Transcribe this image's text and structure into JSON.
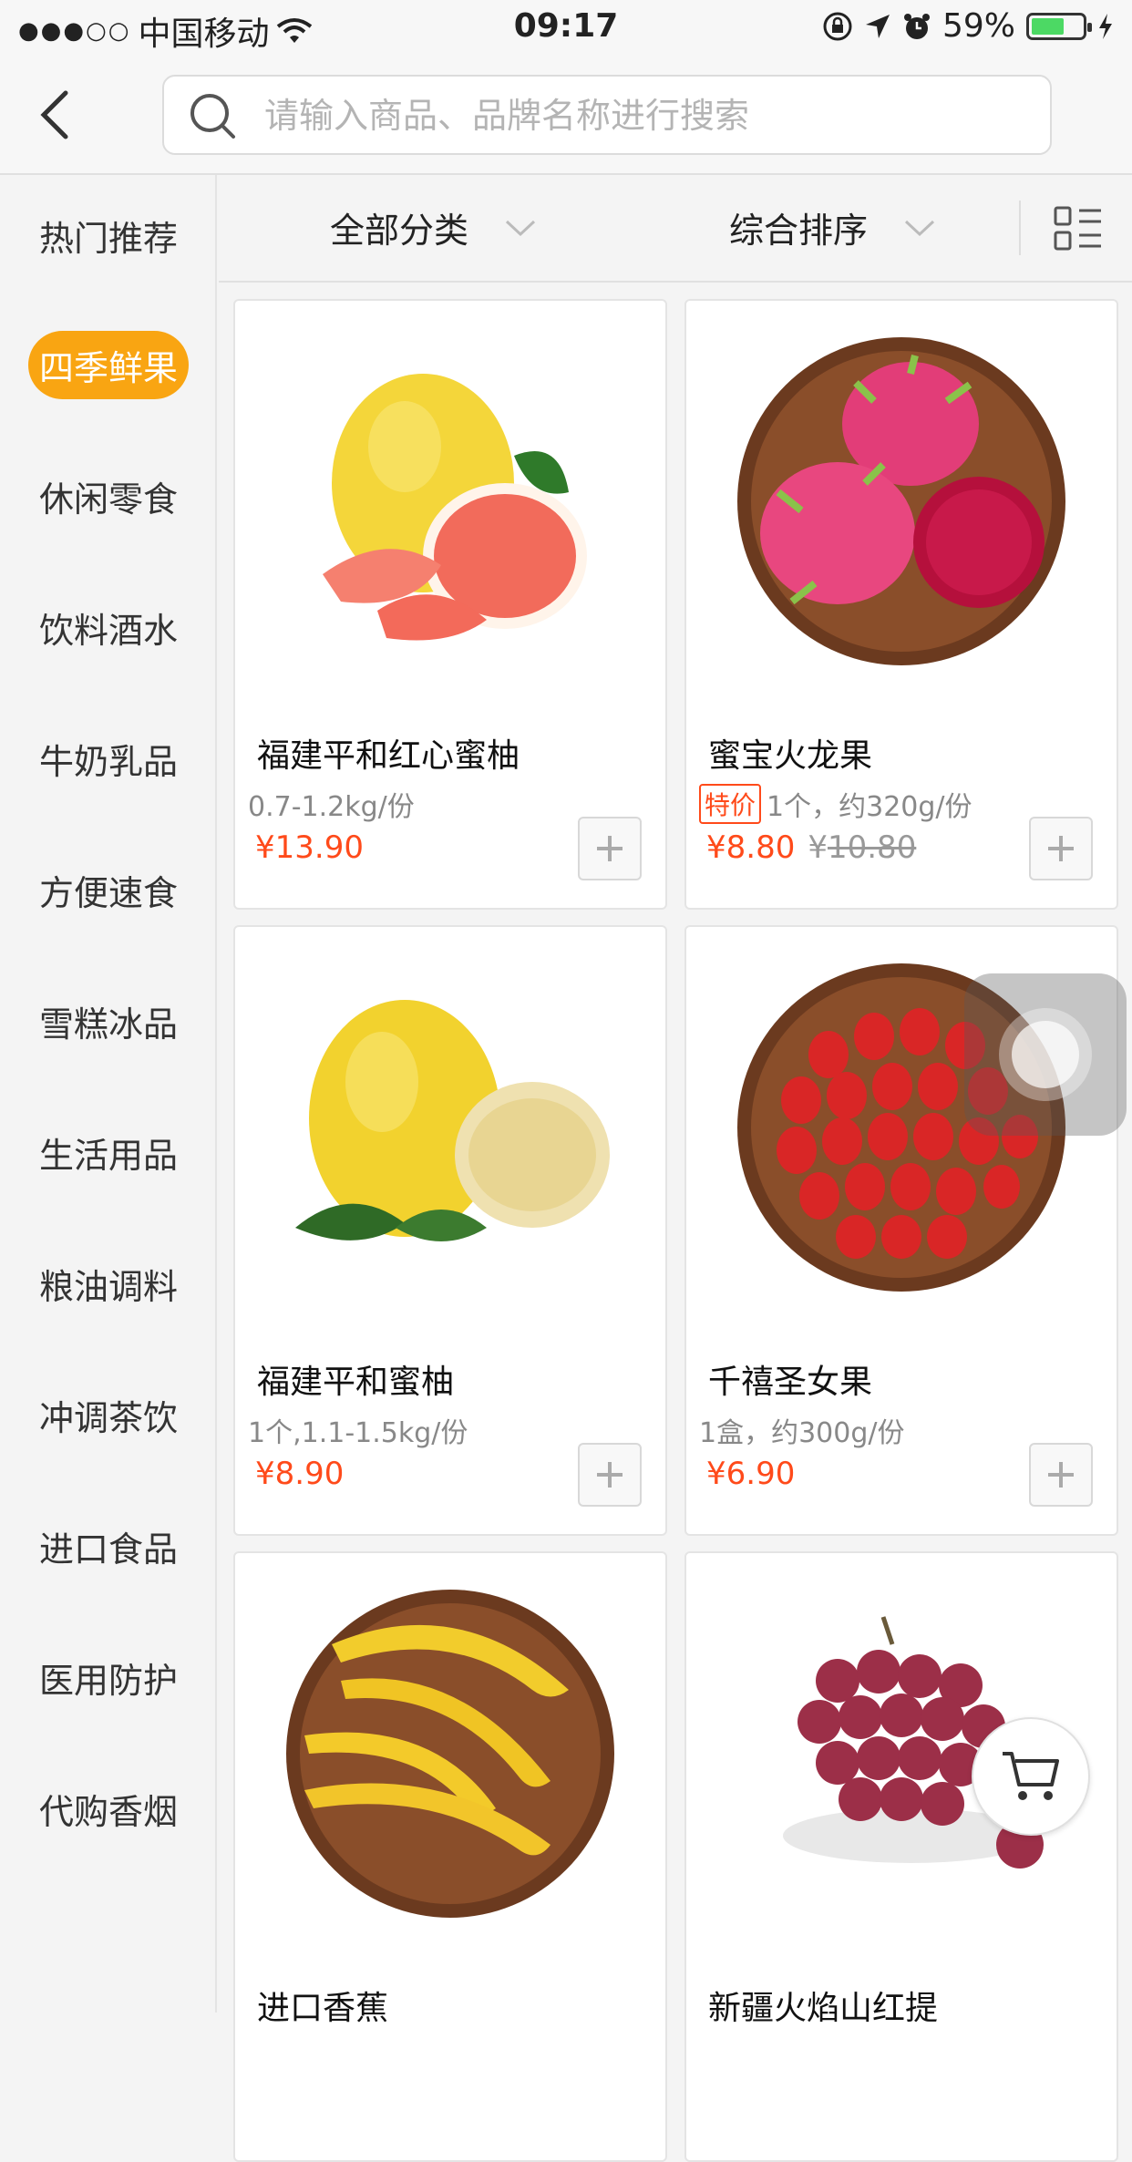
{
  "status_bar": {
    "signal": "●●●○○",
    "carrier": "中国移动",
    "time": "09:17",
    "battery": "59%"
  },
  "search": {
    "placeholder": "请输入商品、品牌名称进行搜索"
  },
  "sidebar": {
    "items": [
      {
        "label": "热门推荐"
      },
      {
        "label": "四季鲜果",
        "active": true
      },
      {
        "label": "休闲零食"
      },
      {
        "label": "饮料酒水"
      },
      {
        "label": "牛奶乳品"
      },
      {
        "label": "方便速食"
      },
      {
        "label": "雪糕冰品"
      },
      {
        "label": "生活用品"
      },
      {
        "label": "粮油调料"
      },
      {
        "label": "冲调茶饮"
      },
      {
        "label": "进口食品"
      },
      {
        "label": "医用防护"
      },
      {
        "label": "代购香烟"
      }
    ]
  },
  "filter": {
    "category": "全部分类",
    "sort": "综合排序"
  },
  "products": [
    {
      "name": "福建平和红心蜜柚",
      "spec": "0.7-1.2kg/份",
      "price": "¥13.90",
      "image": "pomelo-red-icon"
    },
    {
      "name": "蜜宝火龙果",
      "tag": "特价",
      "spec": "1个，约320g/份",
      "price": "¥8.80",
      "old_currency": "¥",
      "old_price": "10.80",
      "image": "dragonfruit-icon"
    },
    {
      "name": "福建平和蜜柚",
      "spec": "1个,1.1-1.5kg/份",
      "price": "¥8.90",
      "image": "pomelo-icon"
    },
    {
      "name": "千禧圣女果",
      "spec": "1盒，约300g/份",
      "price": "¥6.90",
      "image": "cherry-tomato-icon"
    },
    {
      "name": "进口香蕉",
      "image": "banana-icon"
    },
    {
      "name": "新疆火焰山红提",
      "image": "grape-icon"
    }
  ],
  "colors": {
    "accent": "#f9a512",
    "price": "#ff4a1a"
  }
}
